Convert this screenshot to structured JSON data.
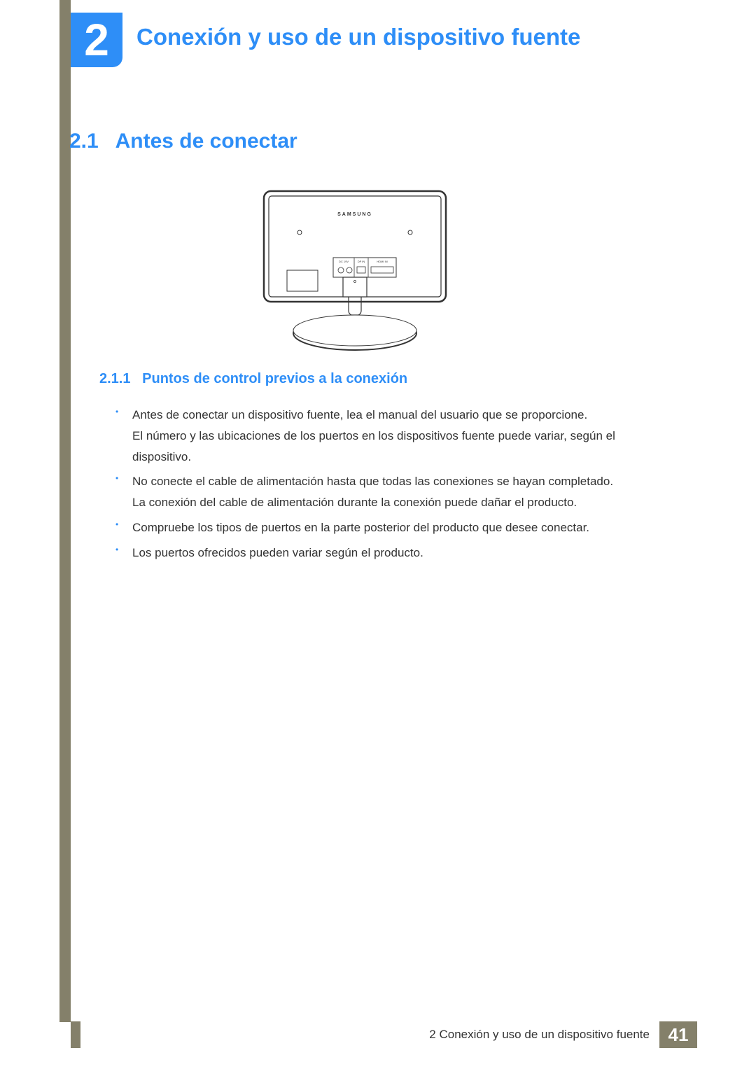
{
  "chapter": {
    "number": "2",
    "title": "Conexión y uso de un dispositivo fuente"
  },
  "section": {
    "number": "2.1",
    "title": "Antes de conectar"
  },
  "subsection": {
    "number": "2.1.1",
    "title": "Puntos de control previos a la conexión"
  },
  "figure": {
    "brand": "SAMSUNG",
    "ports": [
      "DC 19V",
      "DP IN",
      "HDMI IN"
    ]
  },
  "bullets": [
    {
      "lines": [
        "Antes de conectar un dispositivo fuente, lea el manual del usuario que se proporcione.",
        "El número y las ubicaciones de los puertos en los dispositivos fuente puede variar, según el dispositivo."
      ]
    },
    {
      "lines": [
        "No conecte el cable de alimentación hasta que todas las conexiones se hayan completado.",
        "La conexión del cable de alimentación durante la conexión puede dañar el producto."
      ]
    },
    {
      "lines": [
        "Compruebe los tipos de puertos en la parte posterior del producto que desee conectar."
      ]
    },
    {
      "lines": [
        "Los puertos ofrecidos pueden variar según el producto."
      ]
    }
  ],
  "footer": {
    "text": "2 Conexión y uso de un dispositivo fuente",
    "page": "41"
  }
}
